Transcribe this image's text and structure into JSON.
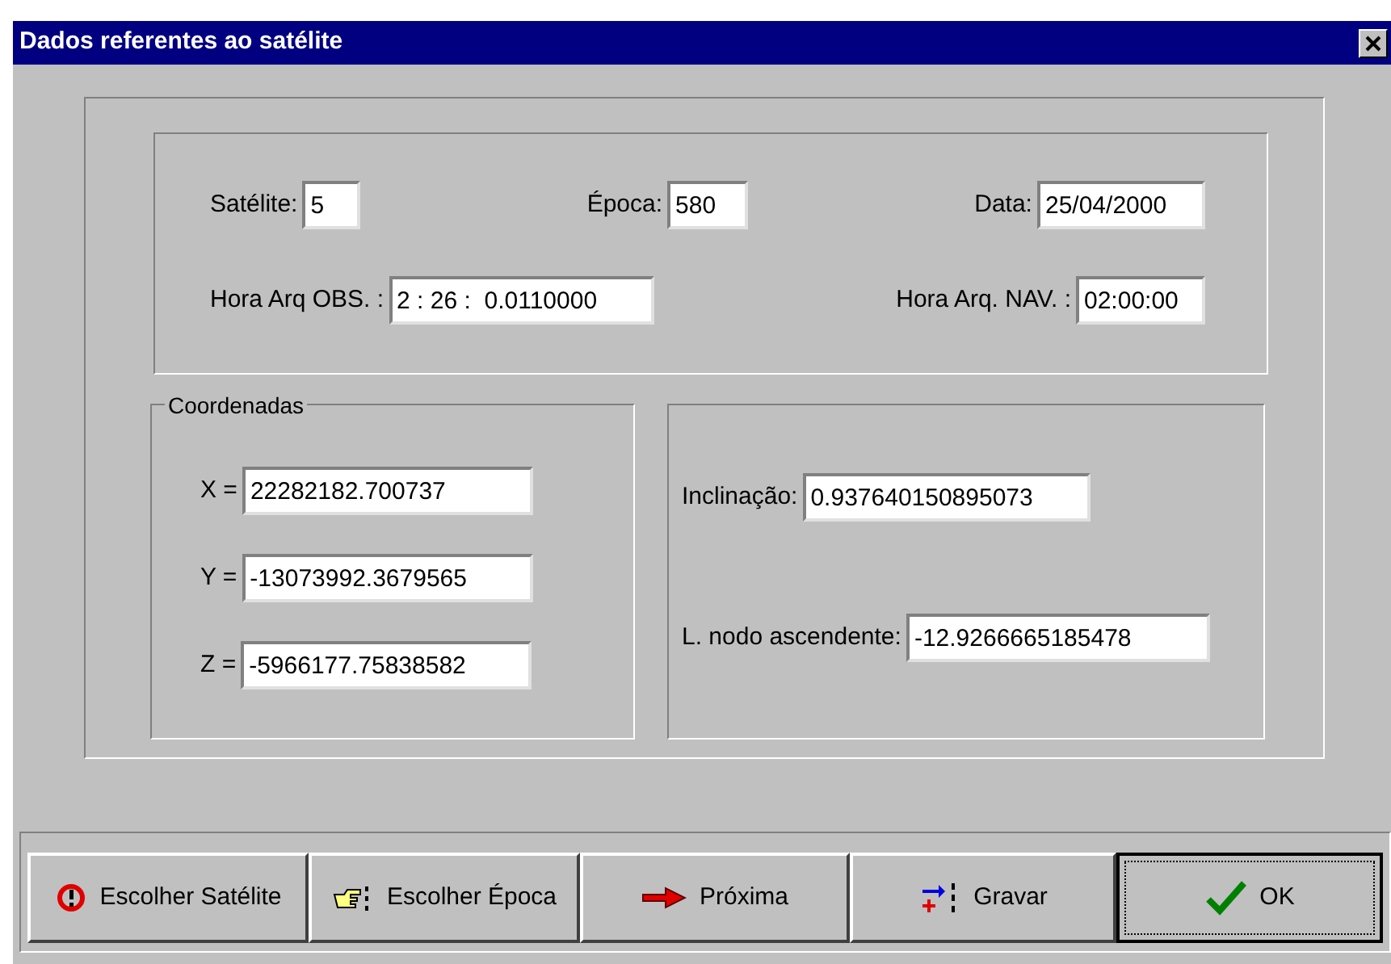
{
  "window": {
    "title": "Dados referentes ao satélite"
  },
  "header_rows": [
    [
      {
        "label": "Satélite:",
        "value": "5"
      },
      {
        "label": "Época:",
        "value": "580"
      },
      {
        "label": "Data:",
        "value": "25/04/2000"
      }
    ],
    [
      {
        "label": "Hora Arq OBS. :",
        "value": "2 : 26 :  0.0110000"
      },
      {
        "label": "Hora Arq. NAV. :",
        "value": "02:00:00"
      }
    ]
  ],
  "coordinates": {
    "title": "Coordenadas",
    "fields": [
      {
        "label": "X =",
        "value": "22282182.700737"
      },
      {
        "label": "Y =",
        "value": "-13073992.3679565"
      },
      {
        "label": "Z =",
        "value": "-5966177.75838582"
      }
    ]
  },
  "orbit_fields": [
    {
      "label": "Inclinação:",
      "value": "0.937640150895073"
    },
    {
      "label": "L. nodo ascendente:",
      "value": "-12.9266665185478"
    }
  ],
  "buttons": [
    {
      "label": "Escolher Satélite",
      "default": false
    },
    {
      "label": "Escolher Época",
      "default": false
    },
    {
      "label": "Próxima",
      "default": false
    },
    {
      "label": "Gravar",
      "default": false
    },
    {
      "label": "OK",
      "default": true
    }
  ]
}
